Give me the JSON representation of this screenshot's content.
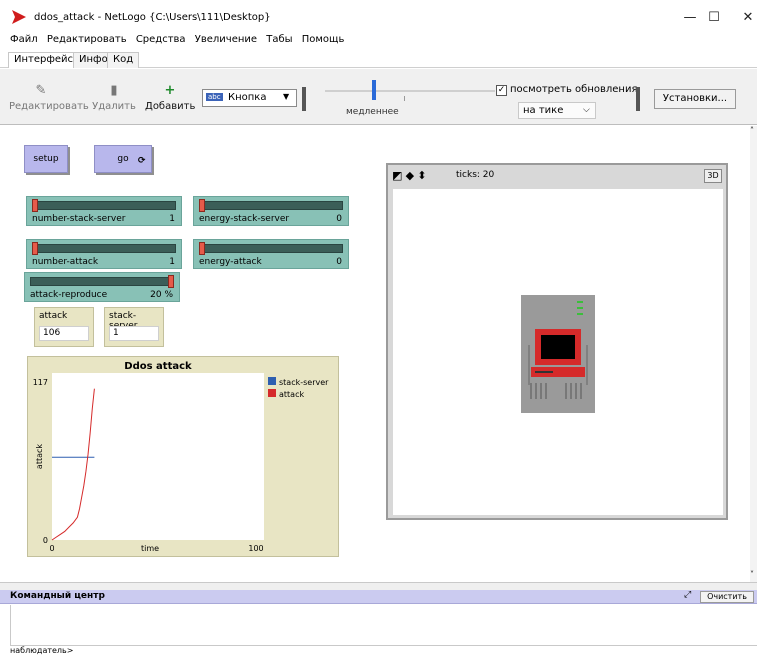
{
  "window": {
    "title": "ddos_attack - NetLogo {C:\\Users\\111\\Desktop}",
    "minimize": "—",
    "maximize": "☐",
    "close": "✕"
  },
  "menu": [
    "Файл",
    "Редактировать",
    "Средства",
    "Увеличение",
    "Табы",
    "Помощь"
  ],
  "tabs": [
    "Интерфейс",
    "Инфо",
    "Код"
  ],
  "toolbar": {
    "edit": "Редактировать",
    "delete": "Удалить",
    "add": "Добавить",
    "widget_type": "Кнопка",
    "widget_icon_text": "abc",
    "speed_label": "медленнее",
    "view_updates_label": "посмотреть обновления",
    "view_updates_checked": true,
    "update_mode": "на тике",
    "settings": "Установки..."
  },
  "buttons": [
    {
      "label": "setup"
    },
    {
      "label": "go"
    }
  ],
  "sliders": [
    {
      "name": "number-stack-server",
      "value": "1",
      "fraction": 0.0
    },
    {
      "name": "energy-stack-server",
      "value": "0",
      "fraction": 0.0
    },
    {
      "name": "number-attack",
      "value": "1",
      "fraction": 0.0
    },
    {
      "name": "energy-attack",
      "value": "0",
      "fraction": 0.0
    },
    {
      "name": "attack-reproduce",
      "value": "20 %",
      "fraction": 1.0
    }
  ],
  "monitors": [
    {
      "name": "attack",
      "value": "106"
    },
    {
      "name": "stack-server",
      "value": "1"
    }
  ],
  "chart_data": {
    "type": "line",
    "title": "Ddos attack",
    "xlabel": "time",
    "ylabel": "attack",
    "xlim": [
      0,
      100
    ],
    "ylim": [
      0,
      117
    ],
    "x_tick_labels": [
      "0",
      "100"
    ],
    "y_tick_labels": [
      "0",
      "117"
    ],
    "legend_position": "right",
    "series": [
      {
        "name": "stack-server",
        "color": "#2e5fb0",
        "x": [
          0,
          20
        ],
        "y": [
          58,
          58
        ]
      },
      {
        "name": "attack",
        "color": "#d52a2a",
        "x": [
          0,
          2,
          4,
          6,
          8,
          10,
          12,
          13,
          14,
          15,
          16,
          17,
          18,
          19,
          20
        ],
        "y": [
          0,
          2,
          4,
          6,
          9,
          12,
          16,
          22,
          30,
          38,
          48,
          60,
          75,
          92,
          106
        ]
      }
    ]
  },
  "view": {
    "ticks_label": "ticks: 20",
    "threed_label": "3D"
  },
  "command_center": {
    "title": "Командный центр",
    "clear": "Очистить",
    "prompt": "наблюдатель>"
  },
  "colors": {
    "accent": "#2a6ad8",
    "button": "#b8b7ec",
    "slider": "#88c1b6",
    "monitor": "#e8e5c4"
  }
}
